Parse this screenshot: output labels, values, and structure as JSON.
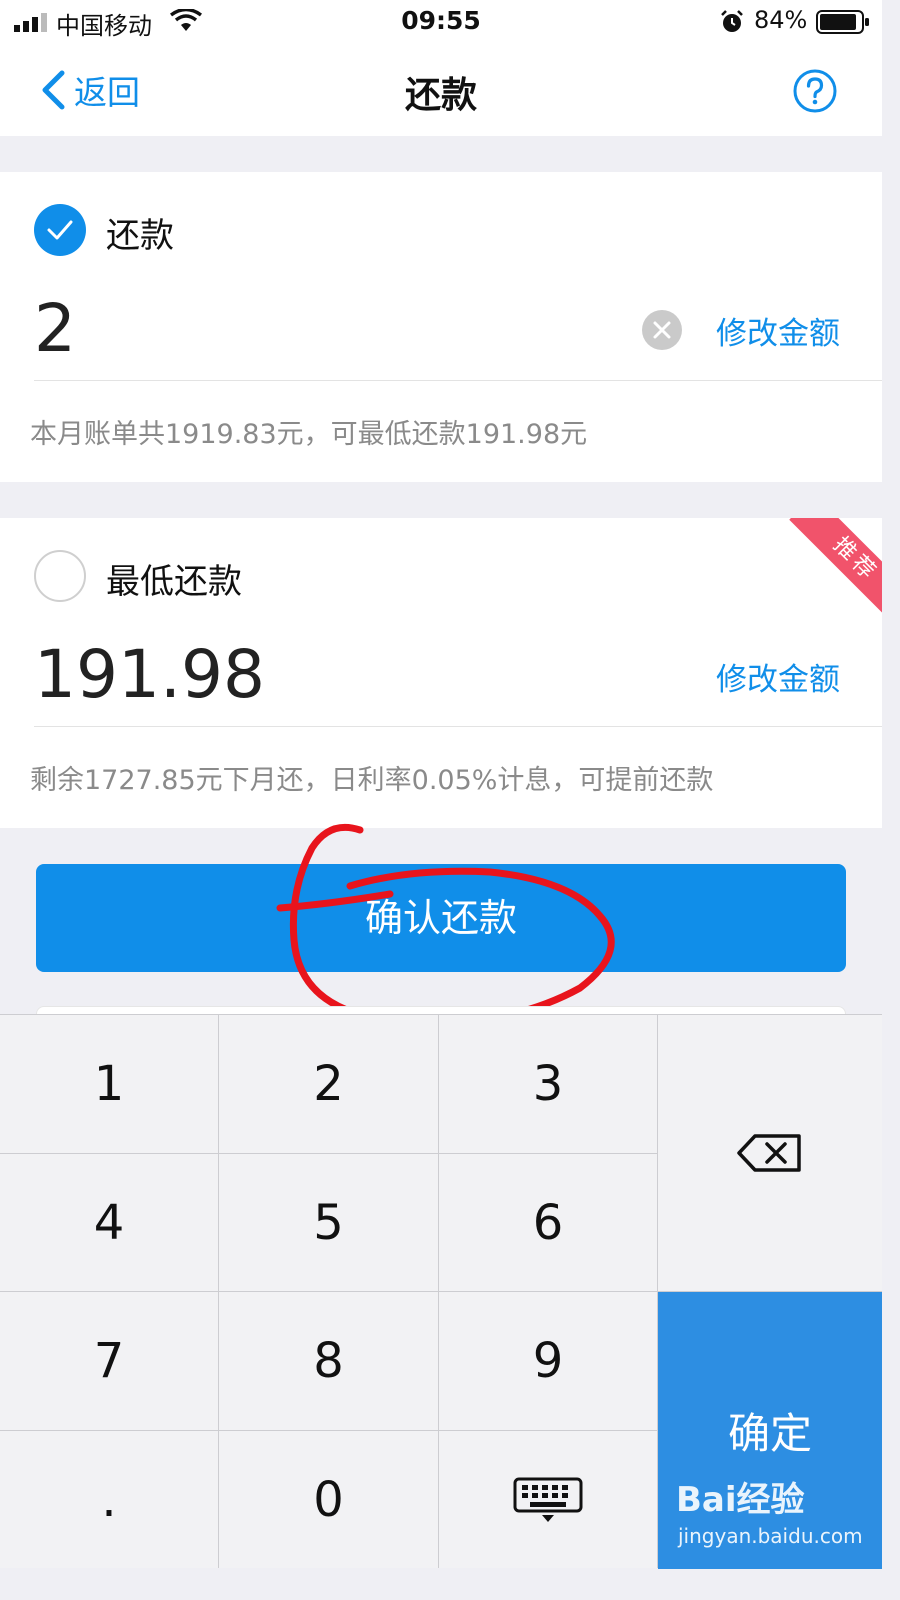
{
  "status_bar": {
    "carrier": "中国移动",
    "time": "09:55",
    "battery": "84%"
  },
  "nav": {
    "back_label": "返回",
    "title": "还款"
  },
  "options": [
    {
      "label": "还款",
      "checked": true,
      "amount": "2",
      "modify_label": "修改金额",
      "hint": "本月账单共1919.83元，可最低还款191.98元"
    },
    {
      "label": "最低还款",
      "checked": false,
      "amount": "191.98",
      "modify_label": "修改金额",
      "hint": "剩余1727.85元下月还，日利率0.05%计息，可提前还款",
      "badge": "推荐"
    }
  ],
  "confirm_button": "确认还款",
  "keypad": {
    "keys": [
      "1",
      "2",
      "3",
      "4",
      "5",
      "6",
      "7",
      "8",
      "9",
      ".",
      "0"
    ],
    "confirm": "确定"
  },
  "watermark": {
    "logo": "Bai经验",
    "url": "jingyan.baidu.com"
  },
  "colors": {
    "accent": "#108ee9",
    "badge": "#f1536b",
    "annotation": "#e8141c",
    "keypad_confirm": "#2d8ee2"
  }
}
